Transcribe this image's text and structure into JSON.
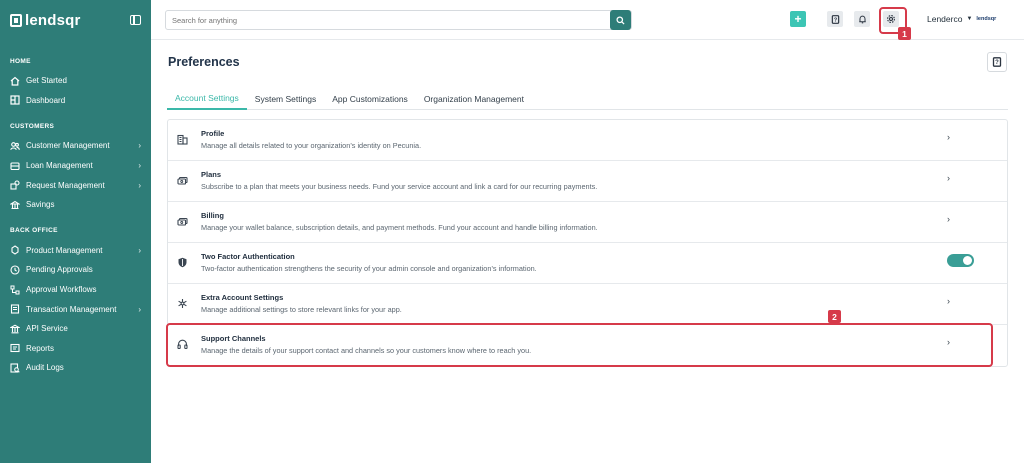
{
  "sidebar": {
    "brand": "lendsqr",
    "sections": [
      {
        "title": "HOME",
        "items": [
          {
            "label": "Get Started",
            "icon": "home-icon",
            "chevron": false
          },
          {
            "label": "Dashboard",
            "icon": "dashboard-icon",
            "chevron": false
          }
        ]
      },
      {
        "title": "CUSTOMERS",
        "items": [
          {
            "label": "Customer Management",
            "icon": "users-icon",
            "chevron": true
          },
          {
            "label": "Loan Management",
            "icon": "loan-icon",
            "chevron": true
          },
          {
            "label": "Request Management",
            "icon": "request-icon",
            "chevron": true
          },
          {
            "label": "Savings",
            "icon": "savings-icon",
            "chevron": false
          }
        ]
      },
      {
        "title": "BACK OFFICE",
        "items": [
          {
            "label": "Product Management",
            "icon": "product-icon",
            "chevron": true
          },
          {
            "label": "Pending Approvals",
            "icon": "clock-icon",
            "chevron": false
          },
          {
            "label": "Approval Workflows",
            "icon": "workflow-icon",
            "chevron": false
          },
          {
            "label": "Transaction Management",
            "icon": "transaction-icon",
            "chevron": true
          },
          {
            "label": "API Service",
            "icon": "api-icon",
            "chevron": false
          },
          {
            "label": "Reports",
            "icon": "reports-icon",
            "chevron": false
          },
          {
            "label": "Audit Logs",
            "icon": "audit-icon",
            "chevron": false
          }
        ]
      }
    ]
  },
  "topbar": {
    "search_placeholder": "Search for anything",
    "user_name": "Lenderco",
    "user_logo": "lendsqr"
  },
  "annotations": {
    "badge1": "1",
    "badge2": "2"
  },
  "page": {
    "title": "Preferences",
    "tabs": [
      "Account Settings",
      "System Settings",
      "App Customizations",
      "Organization Management"
    ],
    "active_tab": 0,
    "rows": [
      {
        "title": "Profile",
        "desc": "Manage all details related to your organization’s identity on Pecunia.",
        "icon": "building-icon",
        "control": "chevron"
      },
      {
        "title": "Plans",
        "desc": "Subscribe to a plan that meets your business needs. Fund your service account and link a card for our recurring payments.",
        "icon": "money-icon",
        "control": "chevron"
      },
      {
        "title": "Billing",
        "desc": "Manage your wallet balance, subscription details, and payment methods. Fund your account and handle billing information.",
        "icon": "money-icon",
        "control": "chevron"
      },
      {
        "title": "Two Factor Authentication",
        "desc": "Two-factor authentication strengthens the security of your admin console and organization’s information.",
        "icon": "shield-icon",
        "control": "toggle"
      },
      {
        "title": "Extra Account Settings",
        "desc": "Manage additional settings to store relevant links for your app.",
        "icon": "asterisk-icon",
        "control": "chevron"
      },
      {
        "title": "Support Channels",
        "desc": "Manage the details of your support contact and channels so your customers know where to reach you.",
        "icon": "headphones-icon",
        "control": "chevron"
      }
    ]
  },
  "colors": {
    "sidebar": "#2e7d78",
    "accent": "#3bb8a9",
    "highlight": "#d63a4a"
  }
}
